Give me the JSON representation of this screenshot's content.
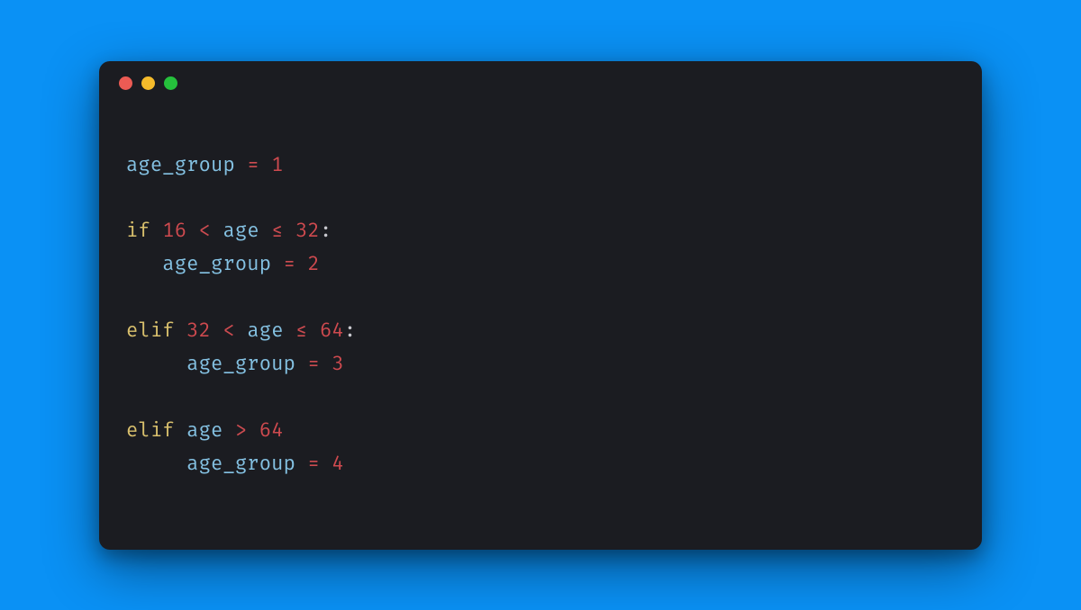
{
  "window": {
    "dots": [
      "red",
      "yellow",
      "green"
    ]
  },
  "code": {
    "lines": [
      {
        "tokens": [
          {
            "cls": "tok-var",
            "t": "age_group"
          },
          {
            "cls": "tok-op",
            "t": " = "
          },
          {
            "cls": "tok-num",
            "t": "1"
          }
        ]
      },
      {
        "tokens": []
      },
      {
        "tokens": [
          {
            "cls": "tok-kw",
            "t": "if"
          },
          {
            "cls": "tok-punc",
            "t": " "
          },
          {
            "cls": "tok-num",
            "t": "16"
          },
          {
            "cls": "tok-op",
            "t": " < "
          },
          {
            "cls": "tok-var",
            "t": "age"
          },
          {
            "cls": "tok-op",
            "t": " ≤ "
          },
          {
            "cls": "tok-num",
            "t": "32"
          },
          {
            "cls": "tok-punc",
            "t": ":"
          }
        ]
      },
      {
        "tokens": [
          {
            "cls": "tok-punc",
            "t": "   "
          },
          {
            "cls": "tok-var",
            "t": "age_group"
          },
          {
            "cls": "tok-op",
            "t": " = "
          },
          {
            "cls": "tok-num",
            "t": "2"
          }
        ]
      },
      {
        "tokens": []
      },
      {
        "tokens": [
          {
            "cls": "tok-kw",
            "t": "elif"
          },
          {
            "cls": "tok-punc",
            "t": " "
          },
          {
            "cls": "tok-num",
            "t": "32"
          },
          {
            "cls": "tok-op",
            "t": " < "
          },
          {
            "cls": "tok-var",
            "t": "age"
          },
          {
            "cls": "tok-op",
            "t": " ≤ "
          },
          {
            "cls": "tok-num",
            "t": "64"
          },
          {
            "cls": "tok-punc",
            "t": ":"
          }
        ]
      },
      {
        "tokens": [
          {
            "cls": "tok-punc",
            "t": "     "
          },
          {
            "cls": "tok-var",
            "t": "age_group"
          },
          {
            "cls": "tok-op",
            "t": " = "
          },
          {
            "cls": "tok-num",
            "t": "3"
          }
        ]
      },
      {
        "tokens": []
      },
      {
        "tokens": [
          {
            "cls": "tok-kw",
            "t": "elif"
          },
          {
            "cls": "tok-punc",
            "t": " "
          },
          {
            "cls": "tok-var",
            "t": "age"
          },
          {
            "cls": "tok-op",
            "t": " > "
          },
          {
            "cls": "tok-num",
            "t": "64"
          }
        ]
      },
      {
        "tokens": [
          {
            "cls": "tok-punc",
            "t": "     "
          },
          {
            "cls": "tok-var",
            "t": "age_group"
          },
          {
            "cls": "tok-op",
            "t": " = "
          },
          {
            "cls": "tok-num",
            "t": "4"
          }
        ]
      }
    ]
  }
}
